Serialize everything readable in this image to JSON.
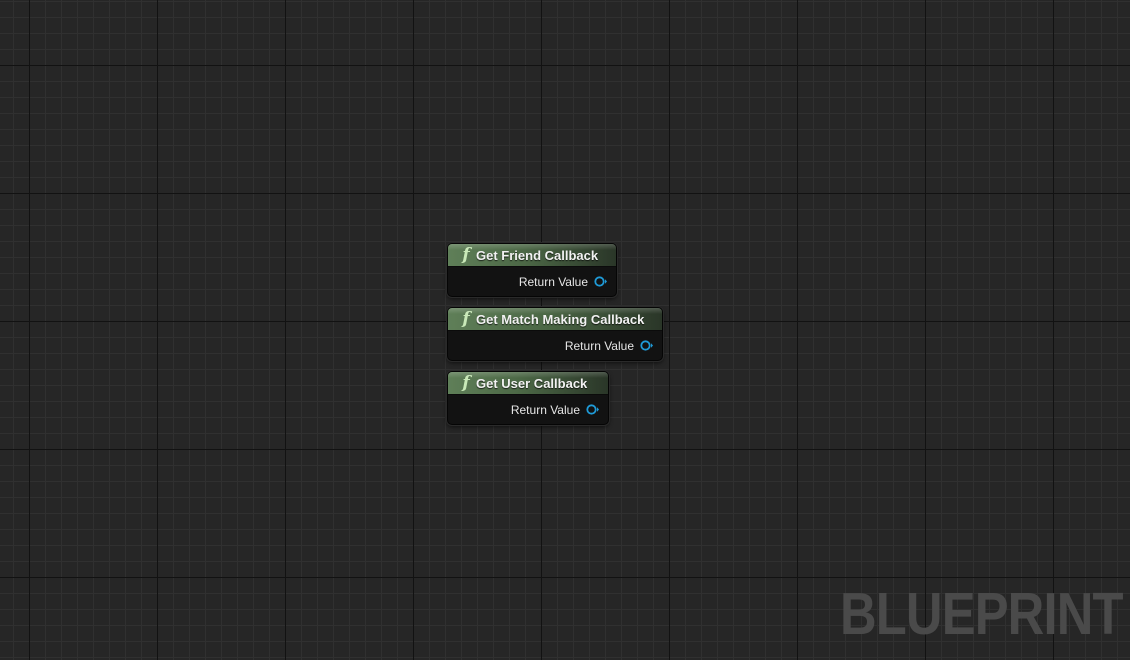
{
  "graph": {
    "watermark": "BLUEPRINT",
    "node_color": "#5f7f58",
    "pin_color": "#1f9bd8",
    "nodes": [
      {
        "icon": "function-icon",
        "icon_glyph": "f",
        "title": "Get Friend Callback",
        "output_pin": {
          "label": "Return Value",
          "icon": "object-pin-icon"
        }
      },
      {
        "icon": "function-icon",
        "icon_glyph": "f",
        "title": "Get Match Making Callback",
        "output_pin": {
          "label": "Return Value",
          "icon": "object-pin-icon"
        }
      },
      {
        "icon": "function-icon",
        "icon_glyph": "f",
        "title": "Get User Callback",
        "output_pin": {
          "label": "Return Value",
          "icon": "object-pin-icon"
        }
      }
    ]
  }
}
